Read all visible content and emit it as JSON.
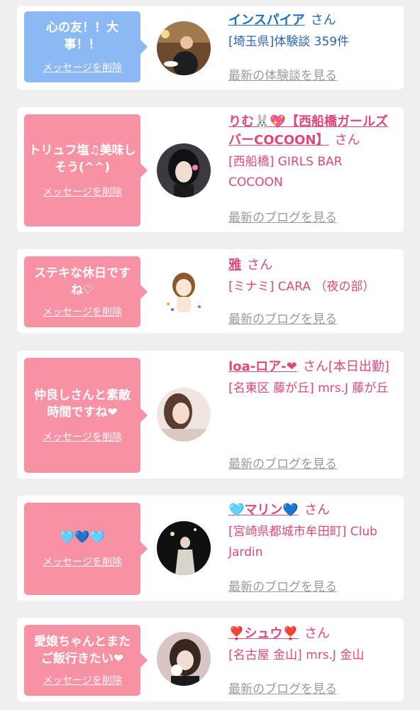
{
  "colors": {
    "blue_bubble": "#8cb8f3",
    "pink_bubble": "#f792a5",
    "pink_text": "#e0477a",
    "blue_text": "#1f6fc2",
    "gray_link": "#9a9a9a"
  },
  "delete_label": "メッセージを削除",
  "san": "さん",
  "items": [
    {
      "message": "心の友！！大事！！",
      "name": "インスパイア",
      "san": "さん",
      "shop": "[埼玉県]体験談 359件",
      "link": "最新の体験談を見る",
      "theme": "blue"
    },
    {
      "message": "トリュフ塩♫美味しそう(^^)",
      "name": "りむ🐰💖【西船橋ガールズバーCOCOON】",
      "san": "さん",
      "shop": "[西船橋] GIRLS BAR COCOON",
      "link": "最新のブログを見る",
      "theme": "pink"
    },
    {
      "message": "ステキな休日ですね♡",
      "name": "雅",
      "san": "さん",
      "shop": "[ミナミ] CARA （夜の部）",
      "link": "最新のブログを見る",
      "theme": "pink"
    },
    {
      "message": "仲良しさんと素敵時間ですね❤",
      "name": "loa-ロア-❤",
      "san": "さん[本日出勤]",
      "shop": "[名東区 藤が丘] mrs.J 藤が丘",
      "link": "最新のブログを見る",
      "theme": "pink"
    },
    {
      "message": "🩵💙🩵",
      "name": "🩵マリン💙",
      "san": "さん",
      "shop": "[宮崎県都城市牟田町] Club Jardin",
      "link": "最新のブログを見る",
      "theme": "pink"
    },
    {
      "message": "愛娘ちゃんとまたご飯行きたい❤",
      "name": "❣️シュウ❣️",
      "san": "さん",
      "shop": "[名古屋 金山] mrs.J 金山",
      "link": "最新のブログを見る",
      "theme": "pink"
    }
  ]
}
